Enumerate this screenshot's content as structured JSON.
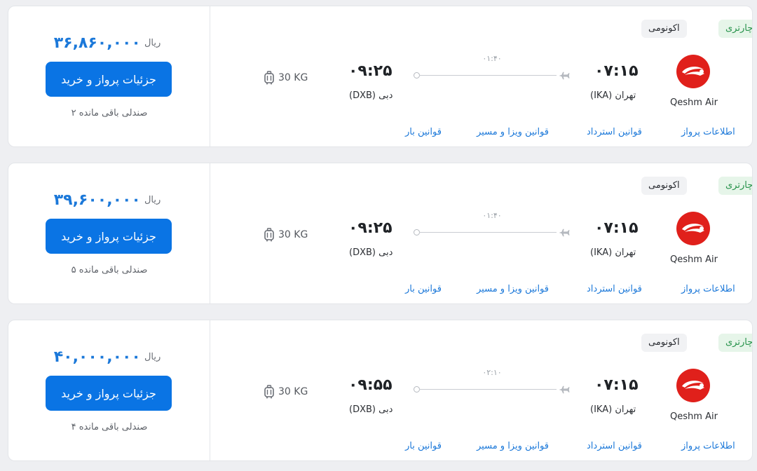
{
  "flights": [
    {
      "price": "۳۶,۸۶۰,۰۰۰",
      "currency": "ریال",
      "buy_label": "جزئیات پرواز و خرید",
      "seats_left": "۲ صندلی باقی مانده",
      "baggage": "30 KG",
      "arrival_time": "۰۹:۲۵",
      "arrival_city": "دبی (DXB)",
      "duration": "۰۱:۴۰",
      "departure_time": "۰۷:۱۵",
      "departure_city": "تهران (IKA)",
      "airline": "Qeshm Air",
      "charter_tag": "چارتری",
      "cabin_tag": "اکونومی",
      "links": [
        "اطلاعات پرواز",
        "قوانین استرداد",
        "قوانین ویزا و مسیر",
        "قوانین بار"
      ]
    },
    {
      "price": "۳۹,۶۰۰,۰۰۰",
      "currency": "ریال",
      "buy_label": "جزئیات پرواز و خرید",
      "seats_left": "۵ صندلی باقی مانده",
      "baggage": "30 KG",
      "arrival_time": "۰۹:۲۵",
      "arrival_city": "دبی (DXB)",
      "duration": "۰۱:۴۰",
      "departure_time": "۰۷:۱۵",
      "departure_city": "تهران (IKA)",
      "airline": "Qeshm Air",
      "charter_tag": "چارتری",
      "cabin_tag": "اکونومی",
      "links": [
        "اطلاعات پرواز",
        "قوانین استرداد",
        "قوانین ویزا و مسیر",
        "قوانین بار"
      ]
    },
    {
      "price": "۴۰,۰۰۰,۰۰۰",
      "currency": "ریال",
      "buy_label": "جزئیات پرواز و خرید",
      "seats_left": "۴ صندلی باقی مانده",
      "baggage": "30 KG",
      "arrival_time": "۰۹:۵۵",
      "arrival_city": "دبی (DXB)",
      "duration": "۰۲:۱۰",
      "departure_time": "۰۷:۱۵",
      "departure_city": "تهران (IKA)",
      "airline": "Qeshm Air",
      "charter_tag": "چارتری",
      "cabin_tag": "اکونومی",
      "links": [
        "اطلاعات پرواز",
        "قوانین استرداد",
        "قوانین ویزا و مسیر",
        "قوانین بار"
      ]
    }
  ],
  "icons": {
    "baggage": "suitcase-icon",
    "plane": "airplane-icon",
    "logo": "qeshm-air-logo"
  },
  "colors": {
    "accent": "#0a74e4",
    "price": "#1b78d9",
    "charter_bg": "#e6f5e9",
    "charter_text": "#26924a",
    "logo_red": "#e0201b"
  }
}
